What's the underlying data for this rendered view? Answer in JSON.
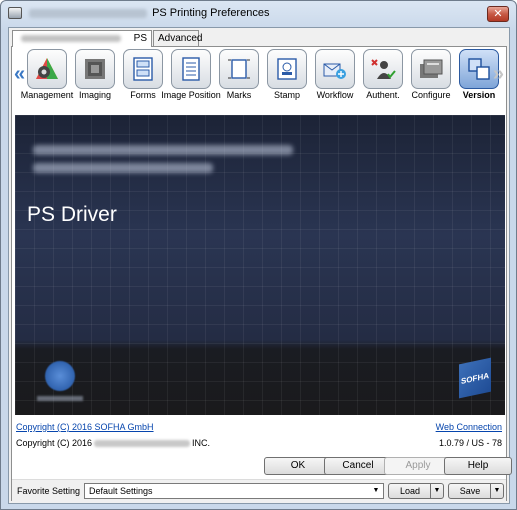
{
  "window": {
    "title": "PS Printing Preferences",
    "close_glyph": "✕"
  },
  "tabs": [
    {
      "label": "PS",
      "selected": true
    },
    {
      "label": "Advanced",
      "selected": false
    }
  ],
  "toolbar": {
    "prev_glyph": "«",
    "next_glyph": "»",
    "items": [
      {
        "label": "Management",
        "icon": "palette-gear-icon"
      },
      {
        "label": "Imaging",
        "icon": "imaging-icon"
      },
      {
        "label": "Forms",
        "icon": "forms-icon"
      },
      {
        "label": "Image Position",
        "icon": "image-position-icon"
      },
      {
        "label": "Marks",
        "icon": "marks-icon"
      },
      {
        "label": "Stamp",
        "icon": "stamp-icon"
      },
      {
        "label": "Workflow",
        "icon": "workflow-icon"
      },
      {
        "label": "Authent.",
        "icon": "authentication-icon"
      },
      {
        "label": "Configure",
        "icon": "configure-icon"
      },
      {
        "label": "Version",
        "icon": "version-icon",
        "active": true
      }
    ]
  },
  "banner": {
    "title": "PS Driver",
    "badge": "SOFHA"
  },
  "info": {
    "copyright_link": "Copyright (C) 2016 SOFHA GmbH",
    "web_connection": "Web Connection",
    "copyright_prefix": "Copyright (C) 2016",
    "copyright_suffix": "INC.",
    "version": "1.0.79 / US - 78"
  },
  "favorite": {
    "label": "Favorite Setting",
    "value": "Default Settings",
    "load_label": "Load",
    "save_label": "Save"
  },
  "buttons": {
    "ok": "OK",
    "cancel": "Cancel",
    "apply": "Apply",
    "help": "Help"
  },
  "colors": {
    "accent": "#3a78c4",
    "banner_bg": "#20283e"
  }
}
